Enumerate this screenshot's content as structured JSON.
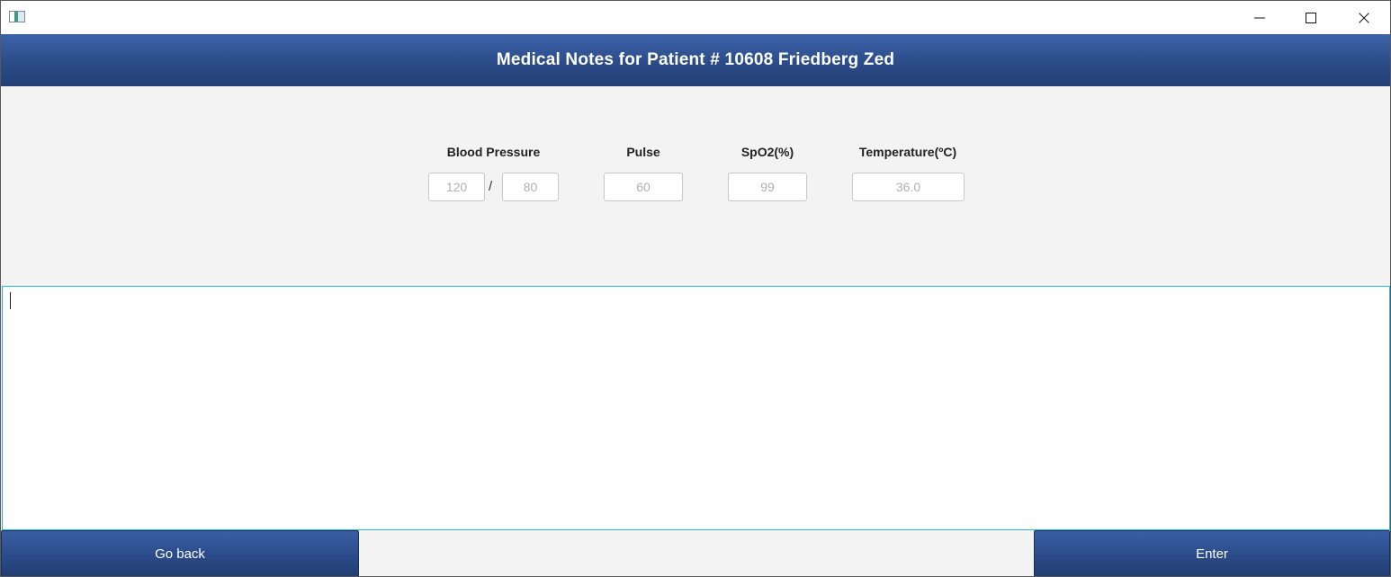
{
  "window": {
    "controls": {
      "minimize_icon": "minimize-icon",
      "maximize_icon": "maximize-icon",
      "close_icon": "close-icon"
    }
  },
  "header": {
    "title": "Medical Notes for Patient # 10608 Friedberg Zed"
  },
  "vitals": {
    "blood_pressure": {
      "label": "Blood Pressure",
      "systolic_placeholder": "120",
      "separator": "/",
      "diastolic_placeholder": "80"
    },
    "pulse": {
      "label": "Pulse",
      "placeholder": "60"
    },
    "spo2": {
      "label": "SpO2(%)",
      "placeholder": "99"
    },
    "temperature": {
      "label": "Temperature(ºC)",
      "placeholder": "36.0"
    }
  },
  "notes": {
    "value": ""
  },
  "footer": {
    "back_label": "Go back",
    "enter_label": "Enter"
  },
  "colors": {
    "accent": "#2b4b88",
    "focus_border": "#2ab5dc"
  }
}
